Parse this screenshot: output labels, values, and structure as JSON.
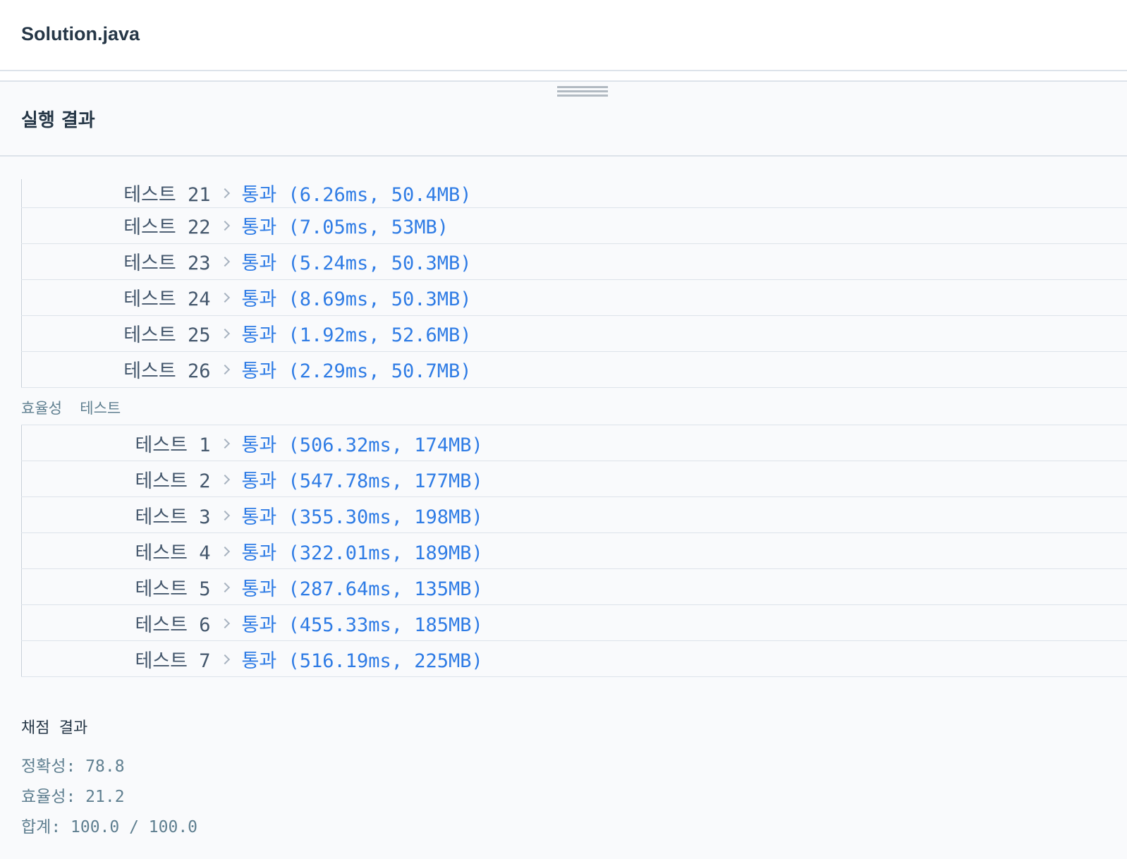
{
  "file_tab": {
    "title": "Solution.java"
  },
  "result_panel": {
    "title": "실행 결과"
  },
  "correctness_tests": [
    {
      "label": "테스트 21",
      "result": "통과 (6.26ms, 50.4MB)"
    },
    {
      "label": "테스트 22",
      "result": "통과 (7.05ms, 53MB)"
    },
    {
      "label": "테스트 23",
      "result": "통과 (5.24ms, 50.3MB)"
    },
    {
      "label": "테스트 24",
      "result": "통과 (8.69ms, 50.3MB)"
    },
    {
      "label": "테스트 25",
      "result": "통과 (1.92ms, 52.6MB)"
    },
    {
      "label": "테스트 26",
      "result": "통과 (2.29ms, 50.7MB)"
    }
  ],
  "efficiency_section": {
    "title": "효율성  테스트"
  },
  "efficiency_tests": [
    {
      "label": "테스트 1",
      "result": "통과 (506.32ms, 174MB)"
    },
    {
      "label": "테스트 2",
      "result": "통과 (547.78ms, 177MB)"
    },
    {
      "label": "테스트 3",
      "result": "통과 (355.30ms, 198MB)"
    },
    {
      "label": "테스트 4",
      "result": "통과 (322.01ms, 189MB)"
    },
    {
      "label": "테스트 5",
      "result": "통과 (287.64ms, 135MB)"
    },
    {
      "label": "테스트 6",
      "result": "통과 (455.33ms, 185MB)"
    },
    {
      "label": "테스트 7",
      "result": "통과 (516.19ms, 225MB)"
    }
  ],
  "score": {
    "title": "채점 결과",
    "correctness": "정확성: 78.8",
    "efficiency": "효율성: 21.2",
    "total": "합계: 100.0 / 100.0"
  },
  "colors": {
    "pass": "#2f7ce5",
    "label": "#44576c",
    "muted": "#5f7f90"
  }
}
